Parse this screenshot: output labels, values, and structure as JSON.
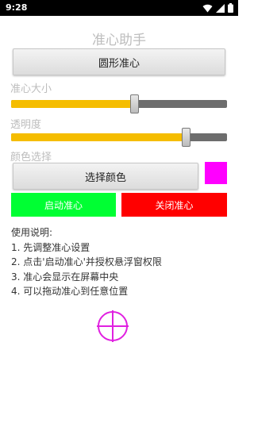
{
  "status_bar": {
    "time": "9:28",
    "icons": [
      "wifi-icon",
      "signal-icon",
      "battery-icon"
    ]
  },
  "app": {
    "title": "准心助手",
    "shape_button": "圆形准心",
    "size_label": "准心大小",
    "size_value": 0.57,
    "opacity_label": "透明度",
    "opacity_value": 0.81,
    "color_label": "颜色选择",
    "pick_color_button": "选择颜色",
    "selected_color": "#ff00ff",
    "start_button": "启动准心",
    "start_color": "#00ff33",
    "stop_button": "关闭准心",
    "stop_color": "#ff0000",
    "instructions_title": "使用说明:",
    "instructions": [
      "1. 先调整准心设置",
      "2. 点击'启动准心'并授权悬浮窗权限",
      "3. 准心会显示在屏幕中央",
      "4. 可以拖动准心到任意位置"
    ],
    "crosshair_color": "#e020e0",
    "slider_fill_color": "#f5bd00"
  }
}
